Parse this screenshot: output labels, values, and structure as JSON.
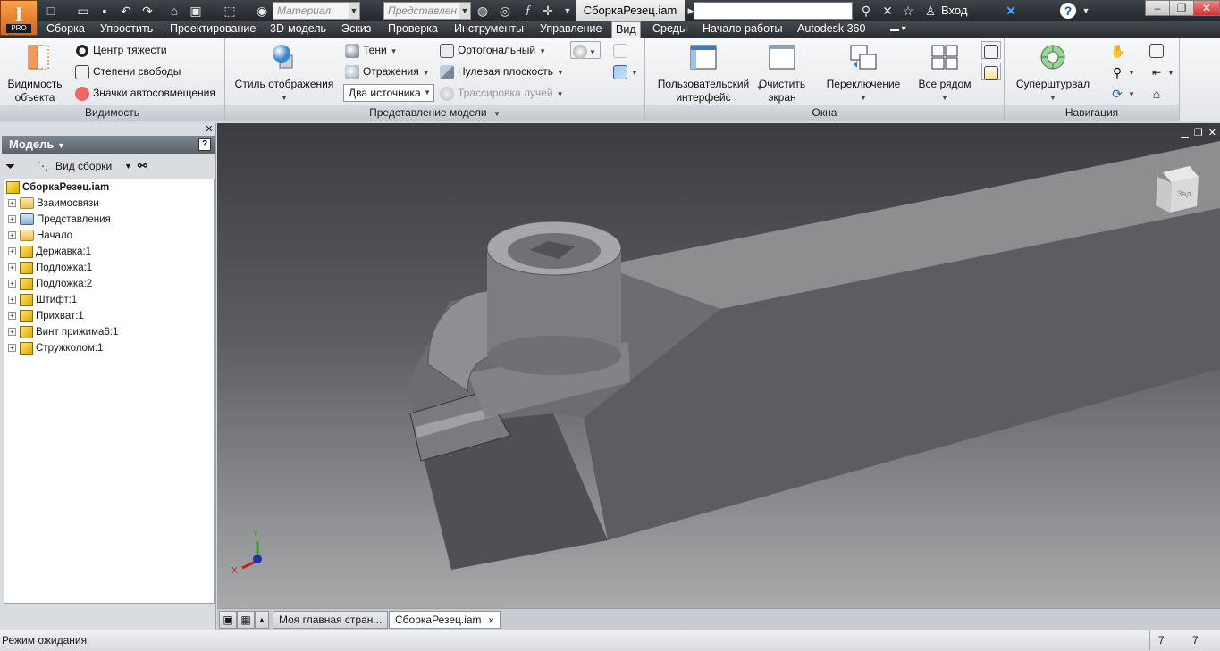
{
  "app": {
    "badge": "PRO",
    "logo": "I"
  },
  "quickaccess": {
    "material_placeholder": "Материал",
    "representation_placeholder": "Представлен",
    "document_title": "СборкаРезец.iam",
    "signin_label": "Вход"
  },
  "tabs": [
    "Сборка",
    "Упростить",
    "Проектирование",
    "3D-модель",
    "Эскиз",
    "Проверка",
    "Инструменты",
    "Управление",
    "Вид",
    "Среды",
    "Начало работы",
    "Autodesk 360"
  ],
  "active_tab": "Вид",
  "ribbon": {
    "visibility": {
      "title": "Видимость",
      "object_visibility": "Видимость\nобъекта",
      "center_gravity": "Центр тяжести",
      "dof": "Степени свободы",
      "autolimits": "Значки автосовмещения"
    },
    "model_view": {
      "title": "Представление модели",
      "display_style": "Стиль отображения",
      "shadows": "Тени",
      "reflections": "Отражения",
      "lighting": "Два источника",
      "orthographic": "Ортогональный",
      "ground_plane": "Нулевая плоскость",
      "ray_tracing": "Трассировка лучей"
    },
    "windows": {
      "title": "Окна",
      "user_interface": "Пользовательский\nинтерфейс",
      "clean_screen": "Очистить\nэкран",
      "switch": "Переключение",
      "tile": "Все рядом"
    },
    "navigation": {
      "title": "Навигация",
      "steering_wheel": "Суперштурвал"
    }
  },
  "browser": {
    "title": "Модель",
    "view_label": "Вид сборки",
    "help": "?",
    "root": "СборкаРезец.iam",
    "items": [
      {
        "label": "Взаимосвязи",
        "kind": "folder"
      },
      {
        "label": "Представления",
        "kind": "rep"
      },
      {
        "label": "Начало",
        "kind": "folder"
      },
      {
        "label": "Державка:1",
        "kind": "part"
      },
      {
        "label": "Подложка:1",
        "kind": "part"
      },
      {
        "label": "Подложка:2",
        "kind": "part"
      },
      {
        "label": "Штифт:1",
        "kind": "part"
      },
      {
        "label": "Прихват:1",
        "kind": "part"
      },
      {
        "label": "Винт прижима6:1",
        "kind": "part"
      },
      {
        "label": "Стружколом:1",
        "kind": "part"
      }
    ]
  },
  "viewcube": {
    "face_label": "Зад"
  },
  "axes": {
    "x": "X",
    "y": "Y"
  },
  "doc_tabs": [
    {
      "label": "Моя главная стран...",
      "active": false
    },
    {
      "label": "СборкаРезец.iam",
      "active": true
    }
  ],
  "status": {
    "text": "Режим ожидания",
    "count1": "7",
    "count2": "7"
  },
  "colors": {
    "accent": "#e8742a",
    "viewport_top": "#3a3c40",
    "viewport_bottom": "#a9aaac"
  }
}
